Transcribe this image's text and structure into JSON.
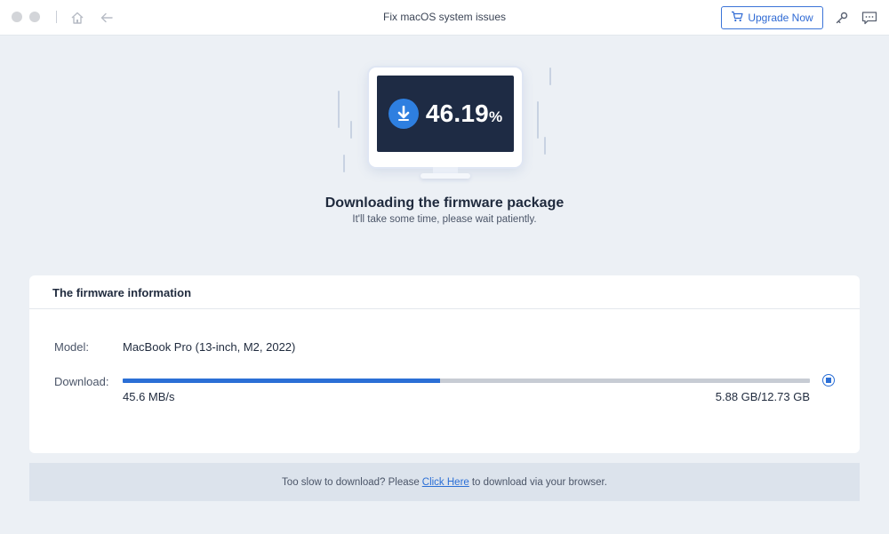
{
  "window": {
    "title": "Fix macOS system issues",
    "upgrade_label": "Upgrade Now"
  },
  "icons": {
    "home": "home-icon",
    "back": "arrow-left-icon",
    "cart": "cart-icon",
    "key": "key-icon",
    "feedback": "chat-feedback-icon",
    "download": "download-arrow-icon",
    "stop": "stop-icon"
  },
  "hero": {
    "percent": "46.19",
    "percent_sign": "%",
    "title": "Downloading the firmware package",
    "subtitle": "It'll take some time, please wait patiently."
  },
  "firmware": {
    "heading": "The firmware information",
    "model_label": "Model:",
    "model_value": "MacBook Pro (13-inch, M2, 2022)",
    "download_label": "Download:",
    "progress": 0.4619,
    "speed": "45.6 MB/s",
    "size": "5.88 GB/12.73 GB"
  },
  "footer": {
    "prefix": "Too slow to download? Please",
    "link": "Click Here",
    "suffix": "to download via your browser."
  },
  "colors": {
    "accent": "#2b6fd6",
    "screen": "#1e2b44",
    "background": "#ecf0f5"
  }
}
